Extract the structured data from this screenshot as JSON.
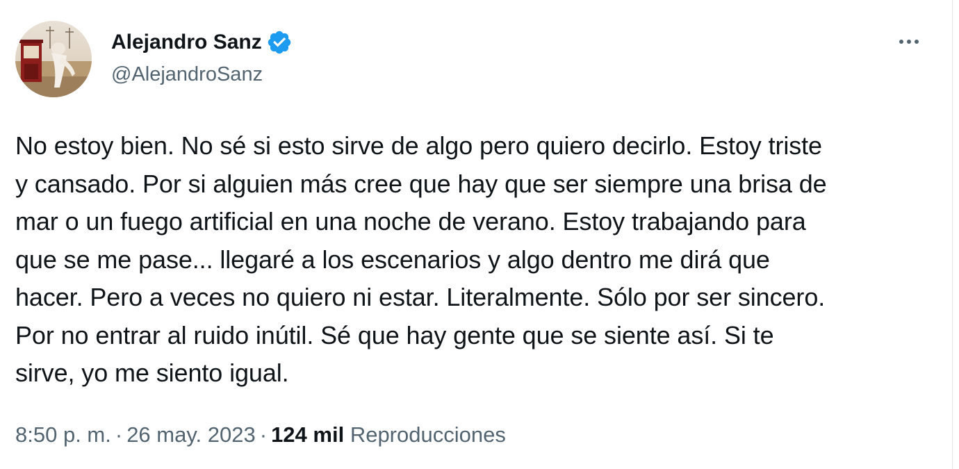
{
  "author": {
    "display_name": "Alejandro Sanz",
    "handle": "@AlejandroSanz",
    "verified": true,
    "verified_color": "#1d9bf0",
    "avatar_icon": "profile-photo"
  },
  "menu": {
    "icon": "more-dots-icon"
  },
  "tweet": {
    "text": "No estoy bien. No sé si esto sirve de algo pero quiero decirlo. Estoy triste\ny cansado. Por si alguien más cree que hay que ser siempre una brisa de\nmar o un fuego artificial en una noche de verano. Estoy trabajando para\nque se me pase... llegaré a los escenarios y algo dentro me dirá que\nhacer. Pero a veces no quiero ni estar. Literalmente. Sólo por ser sincero.\nPor no entrar al ruido inútil. Sé que hay gente que se siente así. Si te\nsirve, yo me siento igual."
  },
  "meta": {
    "time": "8:50 p. m.",
    "separator": "·",
    "date": "26 may. 2023",
    "views_count": "124 mil",
    "views_label": "Reproducciones"
  },
  "colors": {
    "text_primary": "#0f1419",
    "text_secondary": "#536471",
    "accent": "#1d9bf0"
  }
}
